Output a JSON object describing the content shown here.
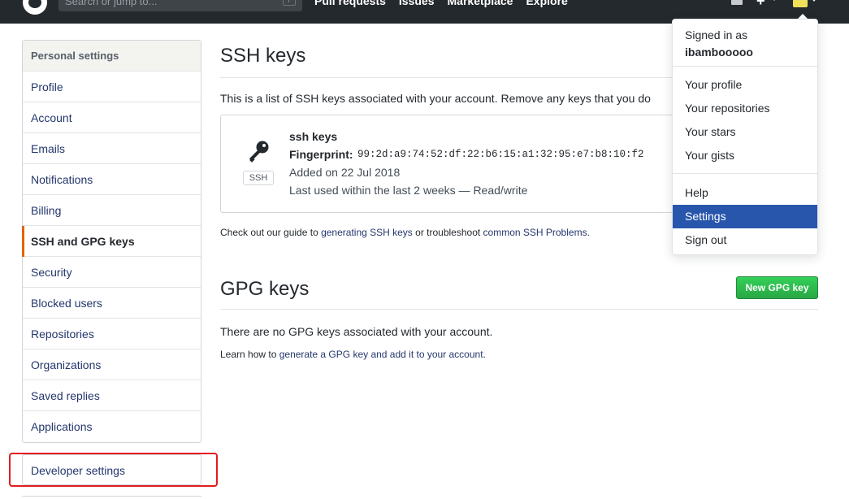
{
  "header": {
    "search_placeholder": "Search or jump to...",
    "search_hotkey": "/",
    "nav": [
      "Pull requests",
      "Issues",
      "Marketplace",
      "Explore"
    ]
  },
  "sidebar": {
    "heading": "Personal settings",
    "items": [
      {
        "label": "Profile"
      },
      {
        "label": "Account"
      },
      {
        "label": "Emails"
      },
      {
        "label": "Notifications"
      },
      {
        "label": "Billing"
      },
      {
        "label": "SSH and GPG keys"
      },
      {
        "label": "Security"
      },
      {
        "label": "Blocked users"
      },
      {
        "label": "Repositories"
      },
      {
        "label": "Organizations"
      },
      {
        "label": "Saved replies"
      },
      {
        "label": "Applications"
      }
    ],
    "selected": "SSH and GPG keys",
    "developer_settings": "Developer settings"
  },
  "ssh": {
    "title": "SSH keys",
    "intro": "This is a list of SSH keys associated with your account. Remove any keys that you do",
    "key": {
      "badge": "SSH",
      "name": "ssh keys",
      "fingerprint_label": "Fingerprint:",
      "fingerprint": "99:2d:a9:74:52:df:22:b6:15:a1:32:95:e7:b8:10:f2",
      "added": "Added on 22 Jul 2018",
      "last_used": "Last used within the last 2 weeks — Read/write"
    },
    "guide": {
      "prefix": "Check out our guide to ",
      "link1": "generating SSH keys",
      "middle": " or troubleshoot ",
      "link2": "common SSH Problems",
      "suffix": "."
    }
  },
  "gpg": {
    "title": "GPG keys",
    "new_button": "New GPG key",
    "empty": "There are no GPG keys associated with your account.",
    "learn": {
      "prefix": "Learn how to ",
      "link": "generate a GPG key and add it to your account",
      "suffix": "."
    }
  },
  "user_menu": {
    "signed_in_label": "Signed in as",
    "username": "ibambooooo",
    "items_profile": [
      "Your profile",
      "Your repositories",
      "Your stars",
      "Your gists"
    ],
    "items_settings": [
      "Help",
      "Settings",
      "Sign out"
    ],
    "active": "Settings"
  },
  "colors": {
    "header_bg": "#24292e",
    "accent_green": "#28a745",
    "menu_active": "#2856ac",
    "selected_marker": "#e36209",
    "highlight_outline": "#e11d1d"
  }
}
